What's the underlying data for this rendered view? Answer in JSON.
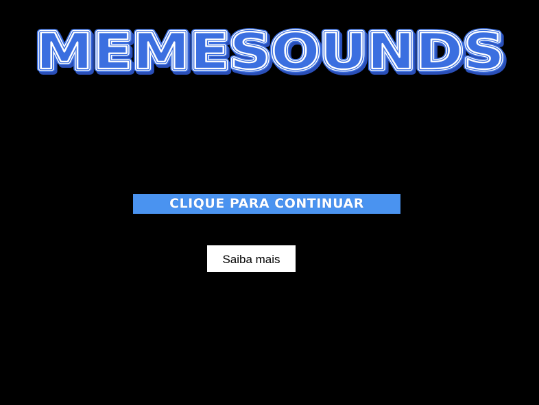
{
  "logo": {
    "text": "MEMESOUNDS",
    "colors": {
      "fill": "#3b6fe0",
      "stripe": "#ffffff",
      "shadow": "#2a4fb8"
    }
  },
  "continue_button": {
    "label": "CLIQUE PARA CONTINUAR",
    "color": "#4a93f0"
  },
  "more_button": {
    "label": "Saiba mais"
  },
  "theme": {
    "background": "#000000"
  }
}
